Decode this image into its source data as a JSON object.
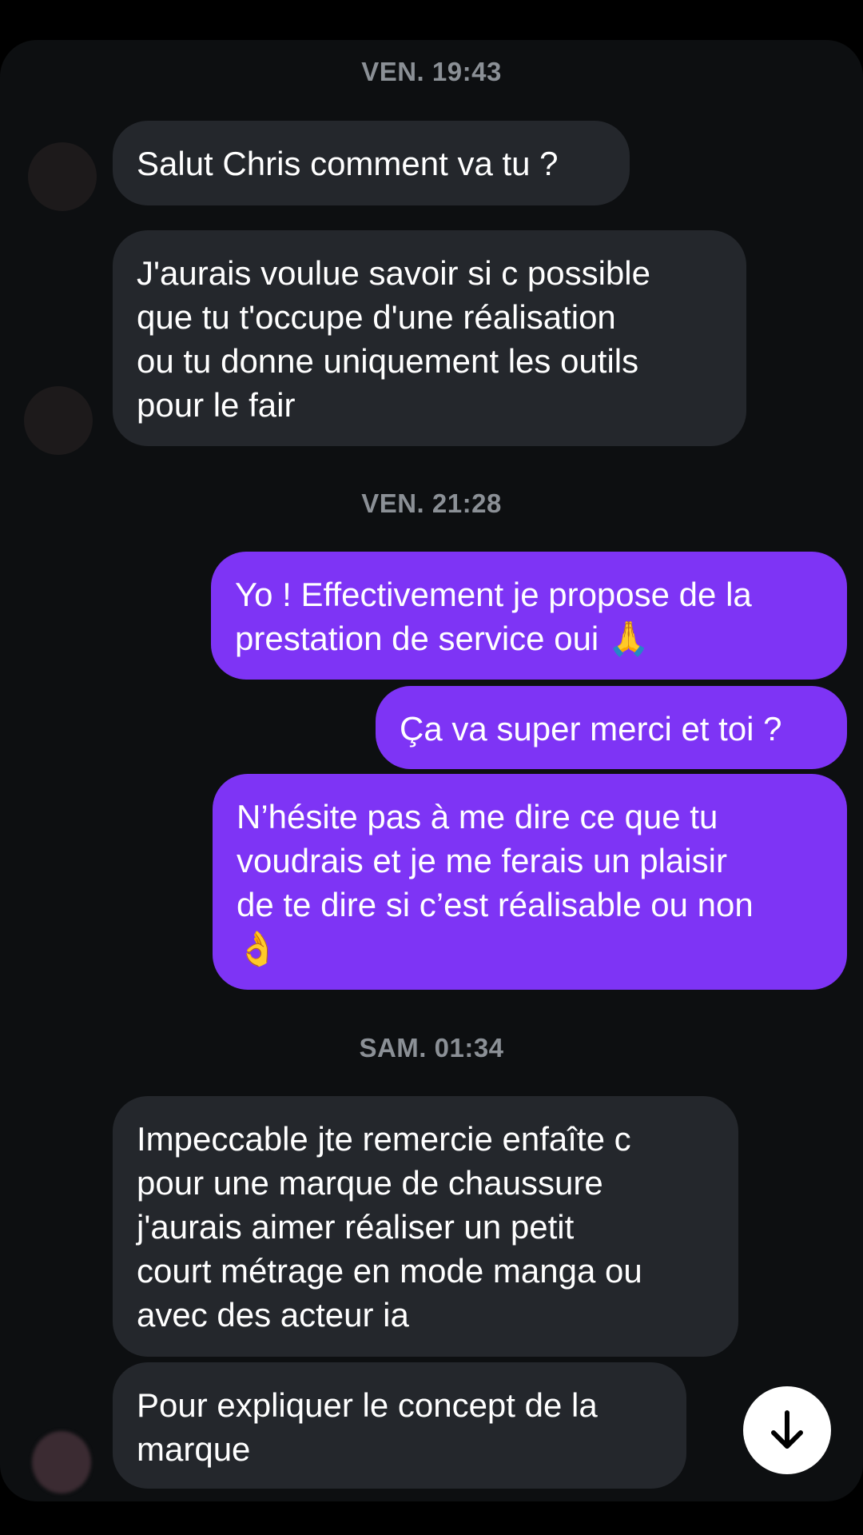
{
  "timestamps": [
    "VEN. 19:43",
    "VEN. 21:28",
    "SAM. 01:34"
  ],
  "messages": [
    {
      "from": "them",
      "text": "Salut Chris comment va tu ?"
    },
    {
      "from": "them",
      "text": "J'aurais voulue savoir si c possible\nque tu t'occupe d'une réalisation\nou tu donne uniquement les outils\npour le fair"
    },
    {
      "from": "me",
      "text": "Yo ! Effectivement je propose de la\nprestation de service oui 🙏"
    },
    {
      "from": "me",
      "text": "Ça va super merci et toi ?"
    },
    {
      "from": "me",
      "text": "N’hésite pas à me dire ce que tu\nvoudrais et je me ferais un plaisir\nde te dire si c’est réalisable ou non\n👌"
    },
    {
      "from": "them",
      "text": "Impeccable jte remercie enfaîte c\npour une marque de chaussure\nj'aurais aimer réaliser un petit\ncourt métrage en mode manga ou\navec des acteur ia"
    },
    {
      "from": "them",
      "text": "Pour expliquer le concept de la\nmarque"
    }
  ],
  "colors": {
    "background": "#0d0f11",
    "incoming_bubble": "#24272c",
    "outgoing_bubble": "#7e34f5",
    "timestamp": "#8b9096"
  },
  "icons": {
    "scroll_down": "arrow-down-icon"
  }
}
